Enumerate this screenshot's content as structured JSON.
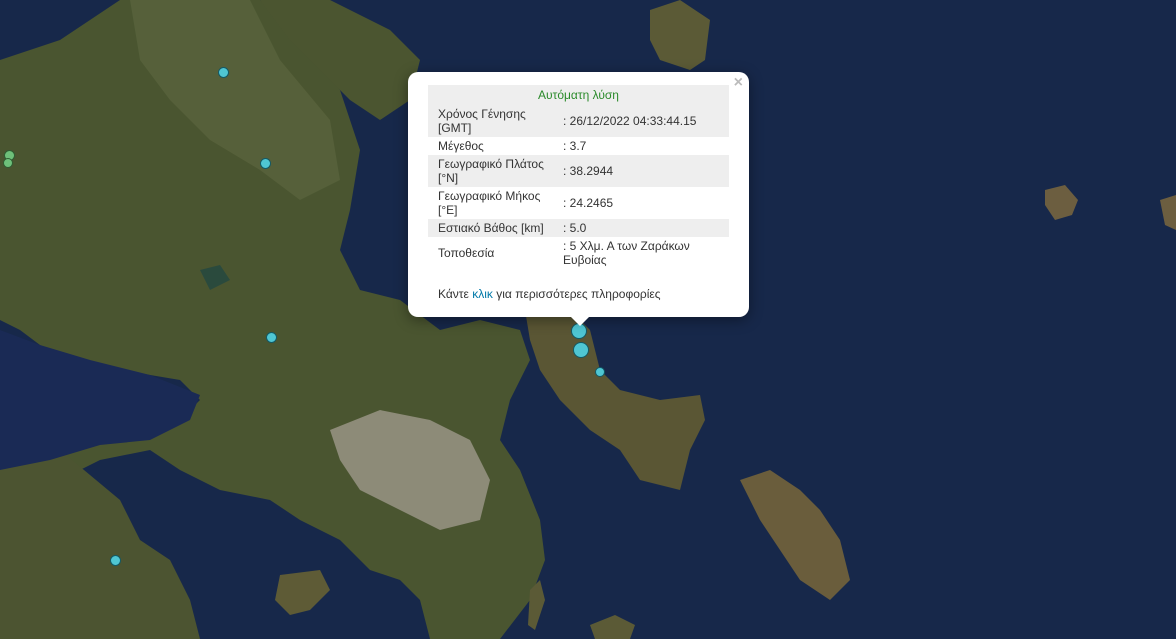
{
  "popup": {
    "header": "Αυτόματη λύση",
    "close_label": "×",
    "rows": [
      {
        "label": "Χρόνος Γένησης [GMT]",
        "value": ": 26/12/2022 04:33:44.15"
      },
      {
        "label": "Μέγεθος",
        "value": ": 3.7"
      },
      {
        "label": "Γεωγραφικό Πλάτος [°N]",
        "value": ": 38.2944"
      },
      {
        "label": "Γεωγραφικό Μήκος [°E]",
        "value": ": 24.2465"
      },
      {
        "label": "Εστιακό Βάθος [km]",
        "value": ": 5.0"
      },
      {
        "label": "Τοποθεσία",
        "value": ": 5 Χλμ. Α των Ζαράκων Ευβοίας"
      }
    ],
    "more_prefix": "Κάντε",
    "more_link": "κλικ",
    "more_suffix": "για περισσότερες πληροφορίες"
  },
  "colors": {
    "sea": "#15243f",
    "land": "#4b5430",
    "marker": "#4fc6d3",
    "header_text": "#2a8a2a",
    "link": "#0078a8"
  }
}
